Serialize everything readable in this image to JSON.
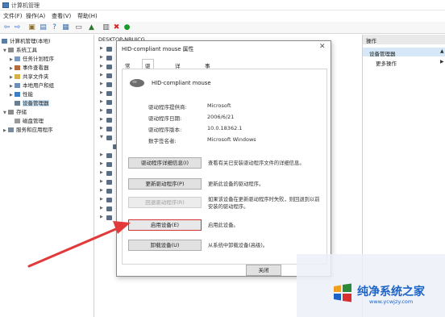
{
  "window": {
    "title": "计算机管理"
  },
  "menu": [
    "文件(F)",
    "操作(A)",
    "查看(V)",
    "帮助(H)"
  ],
  "tree": {
    "root": "计算机管理(本地)",
    "system_tools": "系统工具",
    "items": [
      "任务计划程序",
      "事件查看器",
      "共享文件夹",
      "本地用户和组",
      "性能",
      "设备管理器"
    ],
    "storage": "存储",
    "disk_mgmt": "磁盘管理",
    "services": "服务和应用程序"
  },
  "device_list": {
    "host": "DESKTOP-NBUJCG"
  },
  "actions": {
    "header": "操作",
    "selected": "设备管理器",
    "more": "更多操作"
  },
  "dialog": {
    "title": "HID-compliant mouse 属性",
    "close_glyph": "✕",
    "tabs": [
      "常规",
      "驱动程序",
      "详细信息",
      "事件"
    ],
    "active_tab": "驱动程序",
    "device_name": "HID-compliant mouse",
    "props": [
      {
        "label": "驱动程序提供商:",
        "value": "Microsoft"
      },
      {
        "label": "驱动程序日期:",
        "value": "2006/6/21"
      },
      {
        "label": "驱动程序版本:",
        "value": "10.0.18362.1"
      },
      {
        "label": "数字签名者:",
        "value": "Microsoft Windows"
      }
    ],
    "buttons": [
      {
        "label": "驱动程序详细信息(I)",
        "desc": "查看有关已安装驱动程序文件的详细信息。"
      },
      {
        "label": "更新驱动程序(P)",
        "desc": "更新此设备的驱动程序。"
      },
      {
        "label": "回退驱动程序(R)",
        "desc": "如果该设备在更新驱动程序时失败，则回退到以前安装的驱动程序。"
      },
      {
        "label": "启用设备(E)",
        "desc": "启用此设备。"
      },
      {
        "label": "卸载设备(U)",
        "desc": "从系统中卸载设备(高级)。"
      }
    ],
    "close_button": "关闭"
  },
  "watermark": {
    "name": "纯净系统之家",
    "url": "www.ycwjzy.com"
  },
  "colors": {
    "accent": "#1b63c6",
    "arrow": "#e23a3a",
    "selection": "#cce4f7"
  }
}
